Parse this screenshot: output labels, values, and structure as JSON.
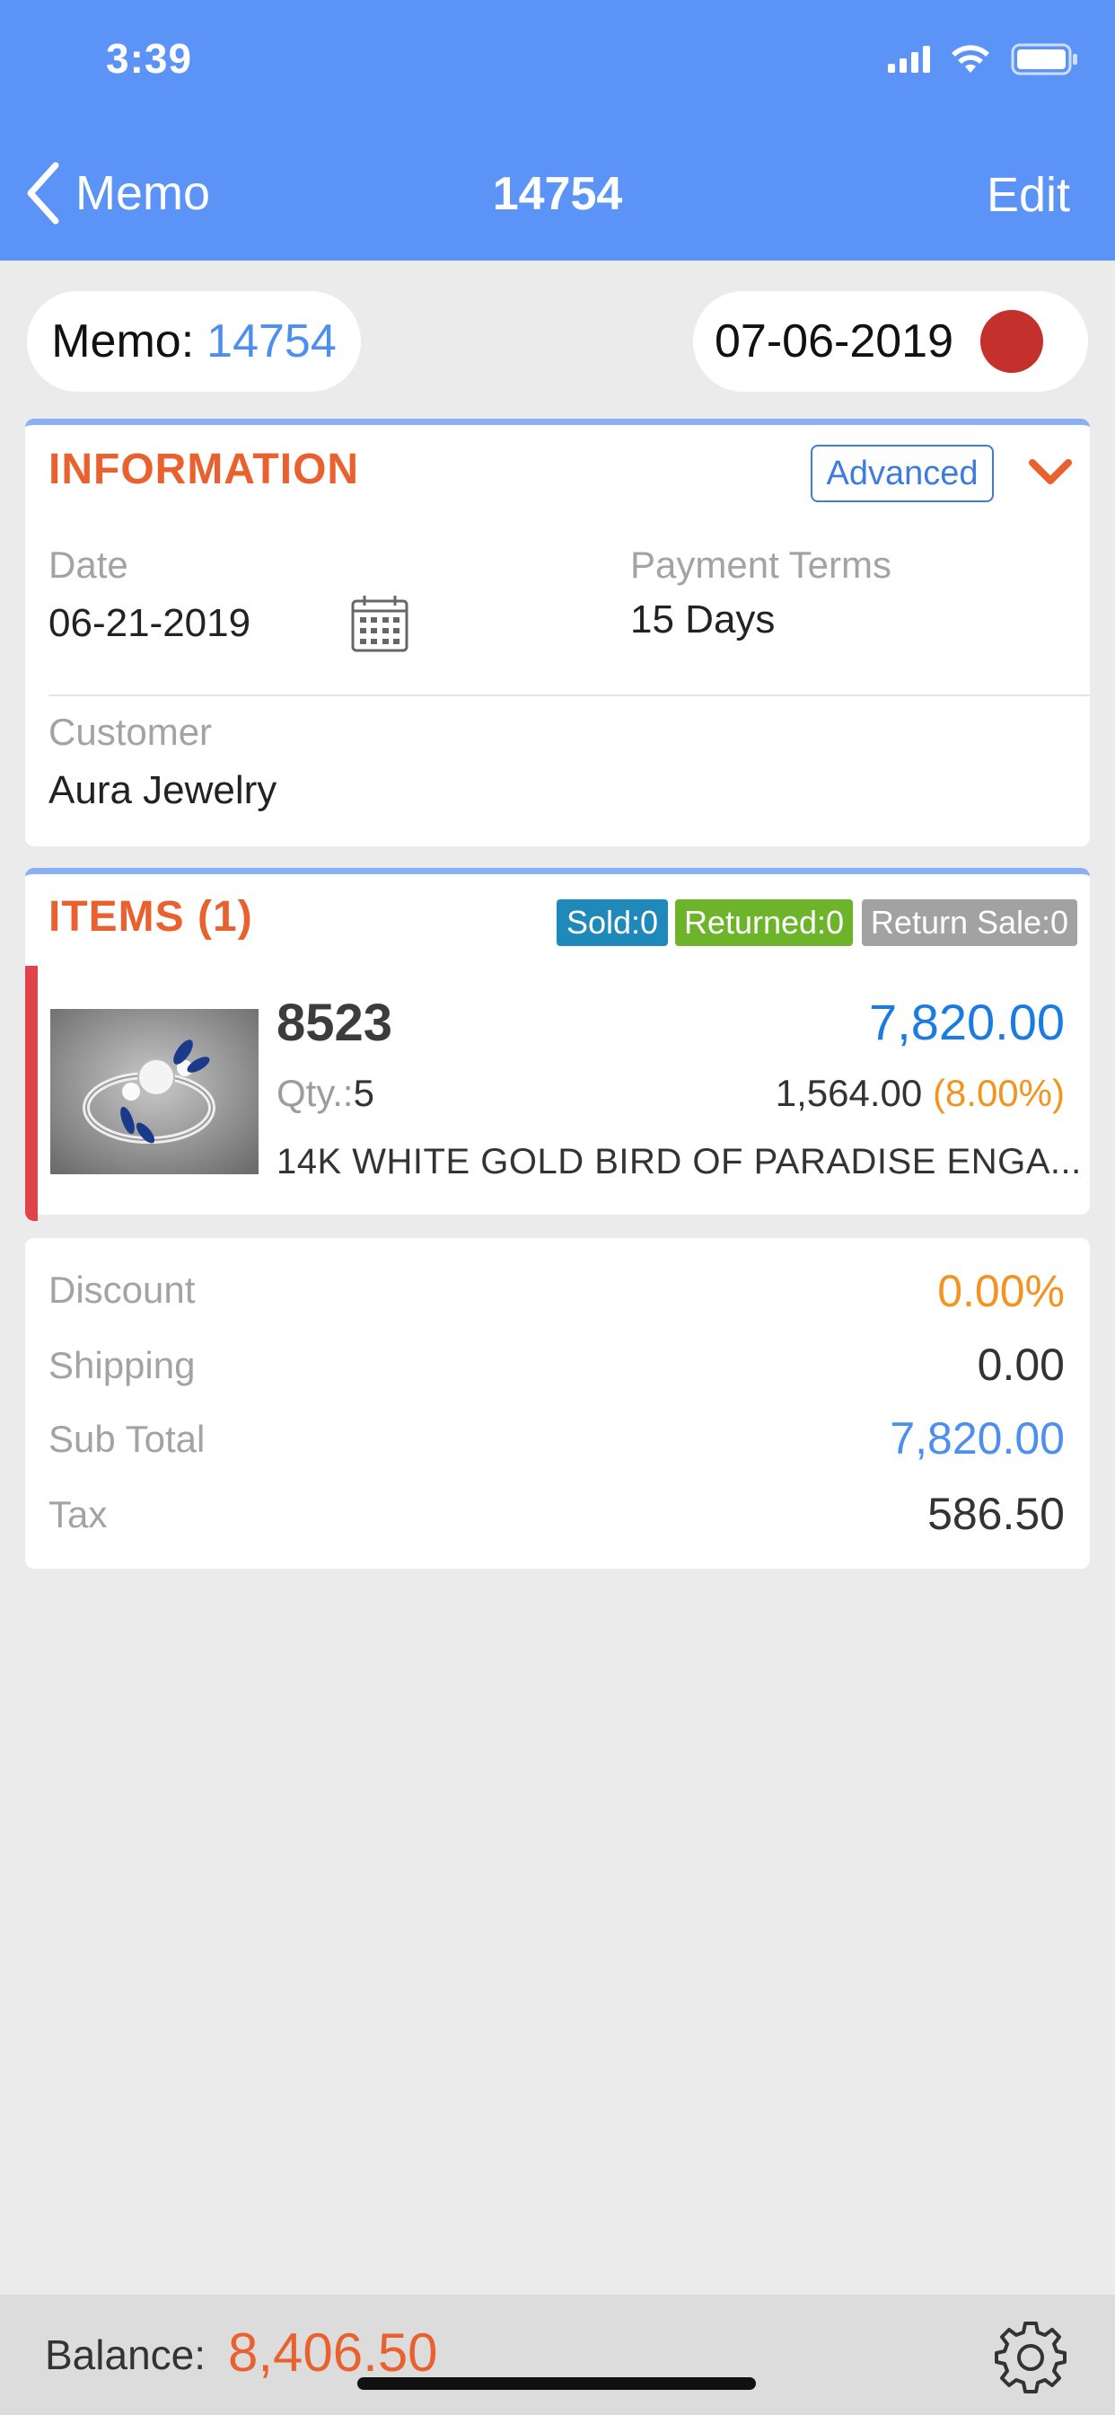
{
  "status_bar": {
    "time": "3:39"
  },
  "nav": {
    "back_label": "Memo",
    "title": "14754",
    "edit_label": "Edit"
  },
  "memo_pill": {
    "label": "Memo:",
    "number": "14754"
  },
  "date_pill": {
    "date": "07-06-2019",
    "status_color": "#c4302b"
  },
  "information": {
    "title": "INFORMATION",
    "advanced_label": "Advanced",
    "date_label": "Date",
    "date_value": "06-21-2019",
    "payment_terms_label": "Payment Terms",
    "payment_terms_value": "15 Days",
    "customer_label": "Customer",
    "customer_value": "Aura Jewelry"
  },
  "items": {
    "title": "ITEMS (1)",
    "badges": {
      "sold": "Sold:0",
      "returned": "Returned:0",
      "return_sale": "Return Sale:0"
    },
    "list": [
      {
        "sku": "8523",
        "amount": "7,820.00",
        "qty_label": "Qty.:",
        "qty": "5",
        "unit_price": "1,564.00",
        "percent": "(8.00%)",
        "description": "14K WHITE GOLD BIRD OF PARADISE ENGA..."
      }
    ]
  },
  "totals": {
    "discount_label": "Discount",
    "discount_value": "0.00%",
    "shipping_label": "Shipping",
    "shipping_value": "0.00",
    "subtotal_label": "Sub Total",
    "subtotal_value": "7,820.00",
    "tax_label": "Tax",
    "tax_value": "586.50"
  },
  "footer": {
    "balance_label": "Balance:",
    "balance_value": "8,406.50"
  },
  "colors": {
    "header_blue": "#5b93f7",
    "accent_orange": "#e8612e",
    "link_blue": "#4d8ef1",
    "amount_blue": "#1a7be0",
    "percent_orange": "#f39320",
    "item_accent_red": "#e0444a"
  }
}
